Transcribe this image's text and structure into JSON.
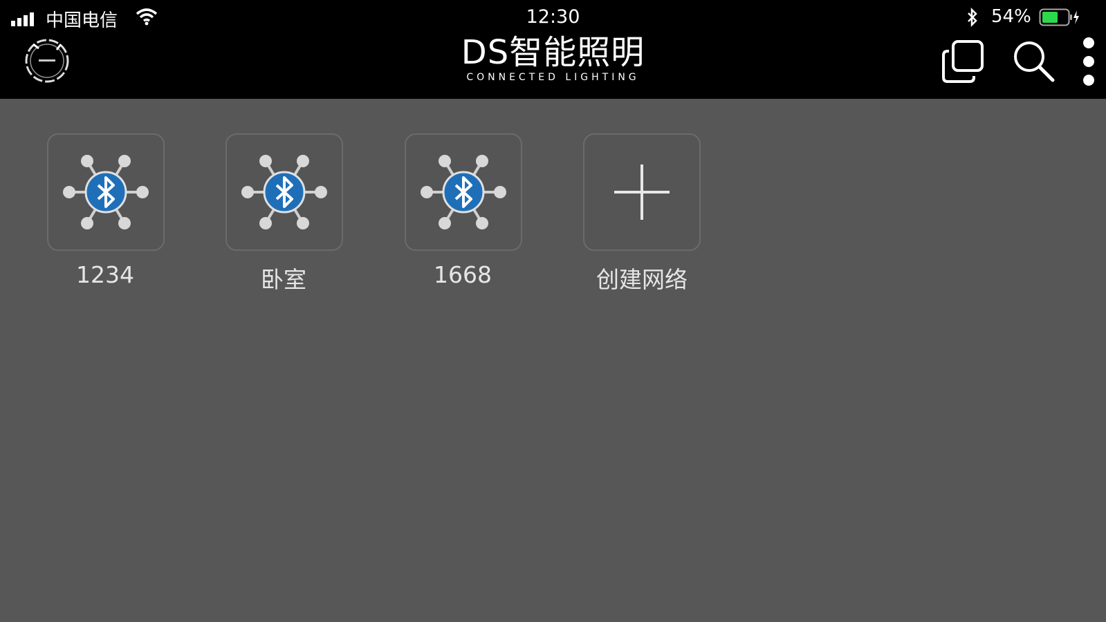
{
  "status_bar": {
    "carrier": "中国电信",
    "time": "12:30",
    "battery": "54%"
  },
  "header": {
    "title": "DS智能照明",
    "subtitle": "CONNECTED LIGHTING",
    "icons": [
      "logo-icon",
      "copy-icon",
      "search-icon",
      "more-vertical-icon"
    ]
  },
  "networks": [
    {
      "label": "1234",
      "icon": "bluetooth-network-icon"
    },
    {
      "label": "卧室",
      "icon": "bluetooth-network-icon"
    },
    {
      "label": "1668",
      "icon": "bluetooth-network-icon"
    }
  ],
  "create": {
    "label": "创建网络",
    "icon": "plus-icon"
  },
  "colors": {
    "header_bg": "#000000",
    "content_bg": "#575757",
    "bluetooth_blue": "#1f6fb8",
    "battery_green": "#2bd94a"
  }
}
